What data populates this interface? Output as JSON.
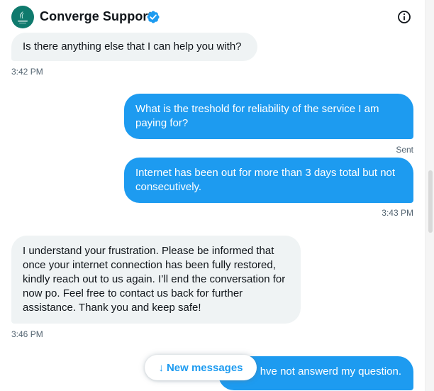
{
  "header": {
    "title": "Converge Support",
    "avatar_icon": "converge-logo",
    "verified_icon": "verified-badge-icon",
    "info_icon": "info-icon",
    "accent": "#1d9bf0"
  },
  "messages": [
    {
      "direction": "in",
      "text": "Is there anything else that I can help you with?",
      "time": "3:42 PM"
    },
    {
      "direction": "out",
      "text": "What is the treshold for reliability of the service I am paying for?",
      "status": "Sent"
    },
    {
      "direction": "out",
      "text": "Internet has been out for more than 3 days total but not consecutively.",
      "time": "3:43 PM"
    },
    {
      "direction": "in",
      "text": "I understand your frustration. Please be informed that once your internet connection has been fully restored, kindly reach out to us again. I’ll end the conversation for now po. Feel free to contact us back for further assistance. Thank you and keep safe!",
      "time": "3:46 PM"
    },
    {
      "direction": "out",
      "text": "hve not answerd my question."
    }
  ],
  "new_messages_button": {
    "arrow": "↓",
    "label": "New messages"
  },
  "colors": {
    "incoming_bubble": "#eff3f4",
    "outgoing_bubble": "#1d9bf0",
    "timestamp": "#536471"
  }
}
